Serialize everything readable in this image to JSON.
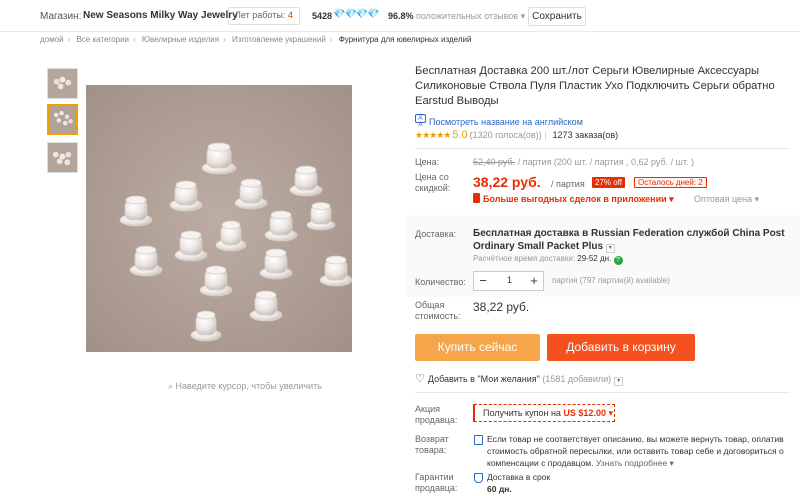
{
  "store": {
    "label": "Магазин:",
    "name": "New Seasons Milky Way Jewelry",
    "years_label": "Лет работы:",
    "years_value": "4",
    "score": "5428",
    "diamonds": "💎💎💎💎",
    "positive_pct": "96.8%",
    "positive_label": "положительных отзывов ▾",
    "save_label": "Сохранить"
  },
  "breadcrumb": [
    "домой",
    "Все категории",
    "Ювелирные изделия",
    "Изготовление украшений",
    "Фурнитура для ювелирных изделий"
  ],
  "zoom_hint": "Наведите курсор, чтобы увеличить",
  "product": {
    "title": "Бесплатная Доставка 200 шт./лот Серьги Ювелирные Аксессуары Силиконовые Ствола Пуля Пластик Ухо Подключить Серьги обратно Earstud Выводы",
    "translate_icon": "文A",
    "translate_label": "Посмотреть название на английском",
    "stars": "★★★★★",
    "rating": "5.0",
    "votes": "(1320 голоса(ов)) ",
    "orders": "1273 заказа(ов)"
  },
  "price": {
    "price_label": "Цена:",
    "old_price": "52,40 руб.",
    "old_price_rest": " / партия  (200 шт. / партия , 0,62 руб. / шт. )",
    "discount_label_1": "Цена со",
    "discount_label_2": "скидкой:",
    "new_price": "38,22 руб.",
    "per_lot": "/ партия",
    "discount": "27% off",
    "days_left": "Осталось дней: 2",
    "app_deal": "Больше выгодных сделок в приложении ▾",
    "wholesale": "Оптовая цена ▾"
  },
  "shipping": {
    "label": "Доставка:",
    "text": "Бесплатная доставка в Russian Federation службой China Post Ordinary Small Packet Plus",
    "eta_label": "Расчётное время доставки: ",
    "eta_value": "29-52 дн.",
    "help": "?"
  },
  "quantity": {
    "label": "Количество:",
    "minus": "−",
    "value": "1",
    "plus": "+",
    "available": "партия (797 партии(й) available)"
  },
  "total": {
    "label_1": "Общая",
    "label_2": "стоимость:",
    "value": "38,22 руб."
  },
  "buttons": {
    "buy_now": "Купить сейчас",
    "add_to_cart": "Добавить в корзину"
  },
  "wishlist": {
    "heart": "♡",
    "label": "Добавить в \"Мои желания\"",
    "count": " (1581 добавили)"
  },
  "promo": {
    "label_1": "Акция",
    "label_2": "продавца:",
    "coupon_text": "Получить купон на ",
    "coupon_value": "US $12.00",
    "coupon_arrow": " ▾"
  },
  "returns": {
    "label_1": "Возврат",
    "label_2": "товара:",
    "text": "Если товар не соответствует описанию, вы можете вернуть товар, оплатив стоимость обратной пересылки, или оставить товар себе и договориться о компенсации с продавцом. ",
    "more": "Узнать подробнее ▾"
  },
  "guarantee": {
    "label_1": "Гарантии",
    "label_2": "продавца:",
    "text": "Доставка в срок",
    "days": "60 дн."
  },
  "colors": {
    "accent_red": "#e62e04",
    "buy_orange": "#f7a54b",
    "cart_orange": "#f4511e",
    "star_gold": "#f29a00",
    "link_blue": "#2b66c8"
  }
}
